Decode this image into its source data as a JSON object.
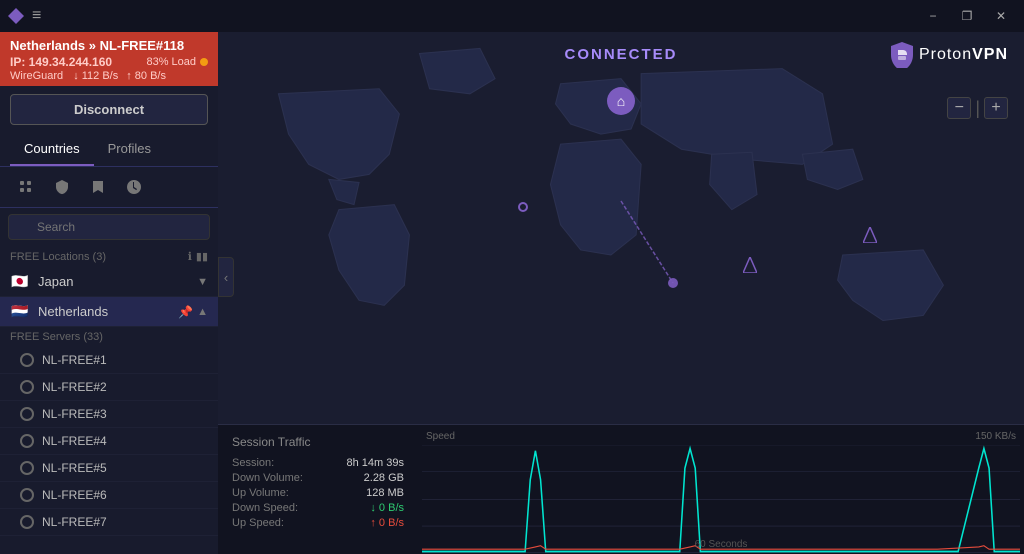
{
  "titlebar": {
    "menu_icon": "≡",
    "minimize_label": "−",
    "restore_label": "❐",
    "close_label": "✕"
  },
  "connection": {
    "server": "Netherlands » NL-FREE#118",
    "ip": "IP: 149.34.244.160",
    "load": "83% Load",
    "protocol": "WireGuard",
    "down_speed": "↓ 112 B/s",
    "up_speed": "↑ 80 B/s"
  },
  "disconnect_label": "Disconnect",
  "tabs": [
    {
      "label": "Countries",
      "active": true
    },
    {
      "label": "Profiles",
      "active": false
    }
  ],
  "search": {
    "placeholder": "Search"
  },
  "free_locations_label": "FREE Locations (3)",
  "countries": [
    {
      "name": "Japan",
      "flag": "🇯🇵",
      "expanded": false
    },
    {
      "name": "Netherlands",
      "flag": "🇳🇱",
      "expanded": true,
      "active": true
    }
  ],
  "free_servers_label": "FREE Servers (33)",
  "servers": [
    "NL-FREE#1",
    "NL-FREE#2",
    "NL-FREE#3",
    "NL-FREE#4",
    "NL-FREE#5",
    "NL-FREE#6",
    "NL-FREE#7"
  ],
  "map": {
    "connected_label": "CONNECTED",
    "proton_text": "Proton",
    "vpn_text": "VPN"
  },
  "zoom": {
    "minus_label": "−",
    "plus_label": "+"
  },
  "session": {
    "title": "Session Traffic",
    "speed_label": "Speed",
    "max_speed": "150 KB/s",
    "time_label": "60 Seconds",
    "rows": [
      {
        "key": "Session:",
        "value": "8h 14m 39s"
      },
      {
        "key": "Down Volume:",
        "value": "2.28 GB"
      },
      {
        "key": "Up Volume:",
        "value": "128 MB"
      },
      {
        "key": "Down Speed:",
        "value": "↓ 0 B/s"
      },
      {
        "key": "Up Speed:",
        "value": "↑ 0 B/s"
      }
    ]
  }
}
